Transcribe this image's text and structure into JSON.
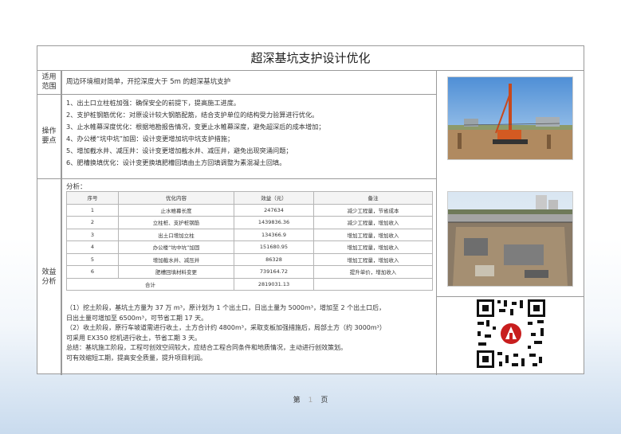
{
  "title": "超深基坑支护设计优化",
  "scope": {
    "label": "适用范围",
    "text": "周边环境相对简单，开挖深度大于 5m 的超深基坑支护"
  },
  "operations": {
    "label": "操作要点",
    "items": [
      "1、出土口立柱桩加强：确保安全的前提下，提高施工进度。",
      "2、支护桩钢筋优化：对原设计较大钢筋配筋，结合支护单位的结构受力验算进行优化。",
      "3、止水帷幕深度优化：根据地勘报告情况，变更止水帷幕深度，避免超深后的成本增加；",
      "4、办公楼“坑中坑”加固：设计变更增加坑中坑支护措施；",
      "5、增加截水井、减压井：设计变更增加截水井、减压井，避免出现突涌问题；",
      "6、肥槽换填优化：设计变更换填肥槽回填由土方回填调整为素混凝土回填。"
    ]
  },
  "analysis": {
    "label": "效益分析",
    "intro": "分析：",
    "table": {
      "headers": [
        "序号",
        "优化内容",
        "效益（元）",
        "备注"
      ],
      "rows": [
        [
          "1",
          "止水帷幕长度",
          "247634",
          "减少工程量，节省成本"
        ],
        [
          "2",
          "立柱桩、支护桩钢筋",
          "1439836.36",
          "减少工程量，增加收入"
        ],
        [
          "3",
          "出土口增加立柱",
          "134366.9",
          "增加工程量，增加收入"
        ],
        [
          "4",
          "办公楼“坑中坑”加固",
          "151680.95",
          "增加工程量，增加收入"
        ],
        [
          "5",
          "增加截水井、减压井",
          "86328",
          "增加工程量，增加收入"
        ],
        [
          "6",
          "肥槽回填材料变更",
          "739164.72",
          "提升单价，增加收入"
        ]
      ],
      "total_label": "合计",
      "total_value": "2819031.13"
    },
    "summary": [
      "（1）挖土阶段，基坑土方量为 37 万 m³，原计划为 1 个出土口，日出土量为 5000m³，增加至 2 个出土口后，",
      "日出土量可增加至 6500m³，可节省工期 17 天。",
      "（2）收土阶段，原行车坡道需进行收土，土方合计约 4800m³，采取支板加强措施后，局部土方（约 3000m³）",
      "可采用 EX350 挖机进行收土，节省工期 3 天。",
      "总结：基坑施工阶段，工程可创效空间较大，应结合工程合同条件和地质情况，主动进行创效策划。",
      "可有效缩短工期，提高安全质量，提升项目利润。"
    ]
  },
  "footer": {
    "page_prefix": "第",
    "page_sep": "1",
    "page_suffix": "页"
  },
  "colors": {
    "border": "#9a9a9a",
    "sky": "#6fa3d8",
    "soil": "#a8825a"
  }
}
